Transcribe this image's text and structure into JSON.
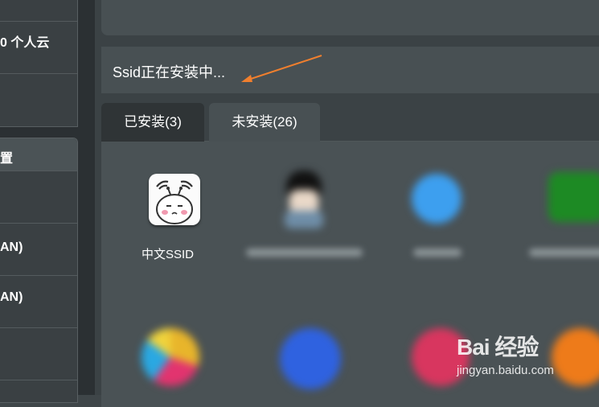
{
  "sidebar": {
    "panel1": {
      "row_label": "0 个人云"
    },
    "panel2": {
      "header": "置",
      "rows": [
        "AN)",
        "AN)"
      ]
    }
  },
  "status": {
    "text": "Ssid正在安装中..."
  },
  "tabs": [
    {
      "label": "已安装(3)",
      "active": true
    },
    {
      "label": "未安装(26)",
      "active": false
    }
  ],
  "apps": [
    {
      "name": "中文SSID",
      "icon": "ssid-wifi-mascot-icon"
    }
  ],
  "watermark": {
    "brand": "Bai 经验",
    "url": "jingyan.baidu.com"
  },
  "colors": {
    "accent_arrow": "#f07f2e",
    "tab_active_bg": "#2f3436"
  }
}
